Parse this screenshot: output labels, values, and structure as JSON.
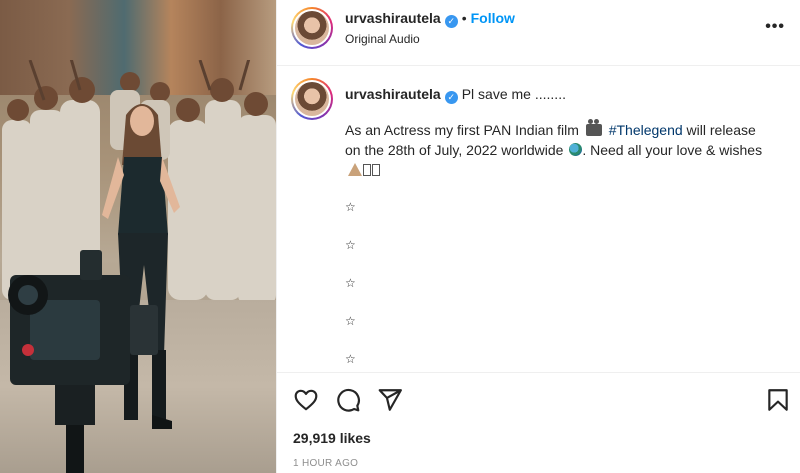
{
  "post": {
    "username": "urvashirautela",
    "follow_label": "Follow",
    "separator": "•",
    "audio_label": "Original Audio",
    "more_label": "•••"
  },
  "caption": {
    "username": "urvashirautela",
    "lead": "Pl save me ........",
    "body_part1": "As an Actress my first PAN Indian film",
    "hashtag": "#Thelegend",
    "body_part2": " will release on the 28th of July, 2022 worldwide",
    "body_part3": ". Need all your love & wishes",
    "star": "☆",
    "star_count": 5
  },
  "stats": {
    "likes": "29,919 likes",
    "time": "1 HOUR AGO"
  },
  "icons": {
    "like": "heart-icon",
    "comment": "comment-icon",
    "share": "send-icon",
    "save": "bookmark-icon",
    "verified": "verified-badge-icon"
  },
  "colors": {
    "follow": "#0095f6",
    "verified": "#3897f0",
    "hashtag": "#00376b",
    "muted": "#8e8e8e"
  }
}
